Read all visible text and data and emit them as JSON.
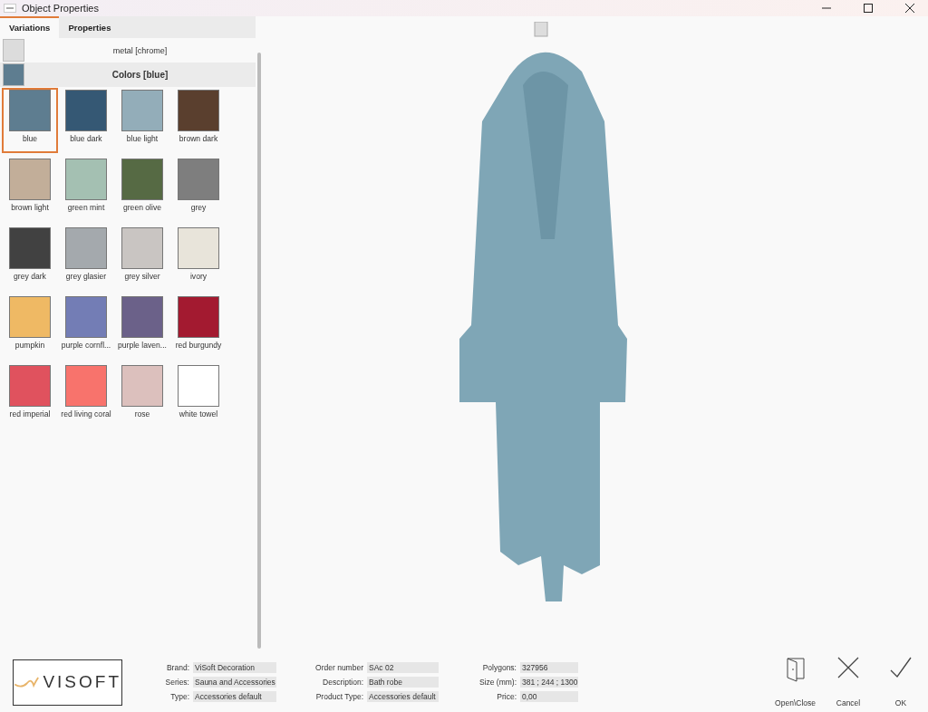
{
  "window": {
    "title": "Object Properties"
  },
  "tabs": [
    {
      "label": "Variations",
      "selected": true
    },
    {
      "label": "Properties",
      "selected": false
    }
  ],
  "variations": [
    {
      "label": "metal  [chrome]",
      "color": "#dcdcdc",
      "selected": false
    },
    {
      "label": "Colors  [blue]",
      "color": "#5e7d90",
      "selected": true
    }
  ],
  "swatches": [
    {
      "label": "blue",
      "color": "#5e7d90",
      "selected": true
    },
    {
      "label": "blue dark",
      "color": "#355874",
      "selected": false
    },
    {
      "label": "blue light",
      "color": "#93adb9",
      "selected": false
    },
    {
      "label": "brown dark",
      "color": "#5a3f2e",
      "selected": false
    },
    {
      "label": "brown light",
      "color": "#c2ae99",
      "selected": false
    },
    {
      "label": "green mint",
      "color": "#a4c0b2",
      "selected": false
    },
    {
      "label": "green olive",
      "color": "#566a44",
      "selected": false
    },
    {
      "label": "grey",
      "color": "#7e7e7e",
      "selected": false
    },
    {
      "label": "grey dark",
      "color": "#414141",
      "selected": false
    },
    {
      "label": "grey glasier",
      "color": "#a4a9ad",
      "selected": false
    },
    {
      "label": "grey silver",
      "color": "#c9c5c2",
      "selected": false
    },
    {
      "label": "ivory",
      "color": "#e8e4da",
      "selected": false
    },
    {
      "label": "pumpkin",
      "color": "#efb964",
      "selected": false
    },
    {
      "label": "purple cornfl...",
      "color": "#737db5",
      "selected": false
    },
    {
      "label": "purple laven...",
      "color": "#6b6189",
      "selected": false
    },
    {
      "label": "red burgundy",
      "color": "#a31a30",
      "selected": false
    },
    {
      "label": "red imperial",
      "color": "#e0525e",
      "selected": false
    },
    {
      "label": "red living coral",
      "color": "#f8736c",
      "selected": false
    },
    {
      "label": "rose",
      "color": "#dcc0bd",
      "selected": false
    },
    {
      "label": "white towel",
      "color": "#ffffff",
      "selected": false
    }
  ],
  "logo": {
    "text": "VISOFT"
  },
  "info": [
    [
      {
        "label": "Brand:",
        "value": "ViSoft Decoration"
      },
      {
        "label": "Series:",
        "value": "Sauna and Accessories"
      },
      {
        "label": "Type:",
        "value": "Accessories default"
      }
    ],
    [
      {
        "label": "Order number",
        "value": "SAc 02"
      },
      {
        "label": "Description:",
        "value": "Bath robe"
      },
      {
        "label": "Product Type:",
        "value": "Accessories default"
      }
    ],
    [
      {
        "label": "Polygons:",
        "value": "327956"
      },
      {
        "label": "Size (mm):",
        "value": "381 ; 244 ; 1300"
      },
      {
        "label": "Price:",
        "value": "0,00"
      }
    ]
  ],
  "actions": [
    {
      "kind": "door",
      "label": "Open\\Close"
    },
    {
      "kind": "cross",
      "label": "Cancel"
    },
    {
      "kind": "check",
      "label": "OK"
    }
  ]
}
